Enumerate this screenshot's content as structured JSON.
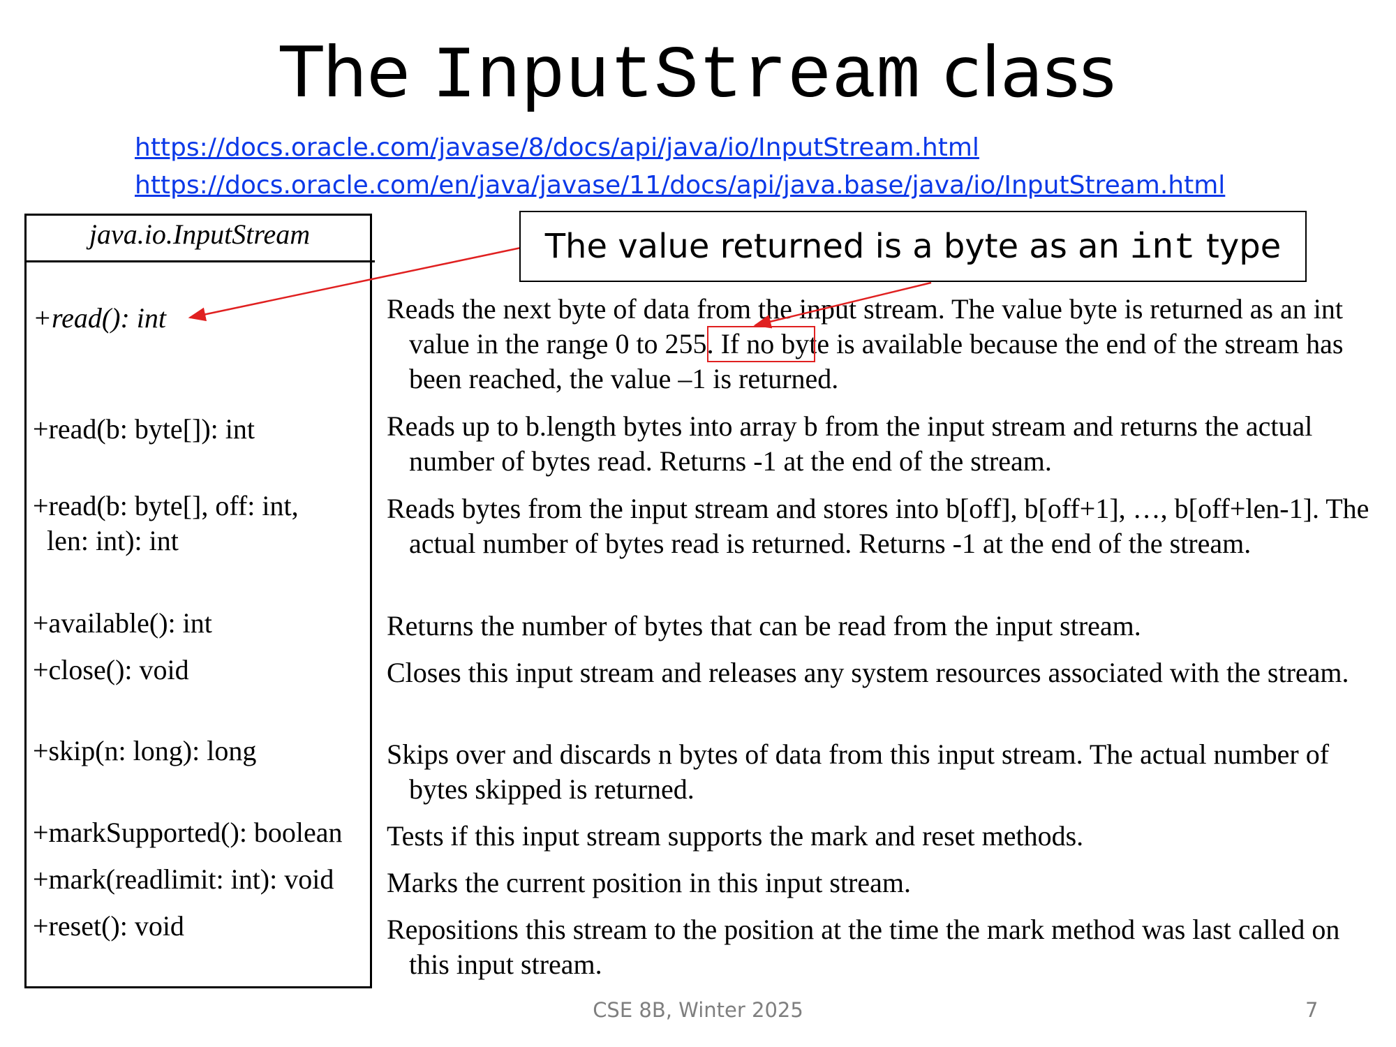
{
  "title": {
    "pre": "The ",
    "code": "InputStream",
    "post": " class"
  },
  "links": [
    "https://docs.oracle.com/javase/8/docs/api/java/io/InputStream.html",
    "https://docs.oracle.com/en/java/javase/11/docs/api/java.base/java/io/InputStream.html"
  ],
  "uml": {
    "class_name": "java.io.InputStream",
    "methods": [
      "+read(): int",
      "+read(b: byte[]): int",
      "+read(b: byte[], off: int,",
      "len: int): int",
      "+available(): int",
      "+close(): void",
      "+skip(n: long): long",
      "+markSupported(): boolean",
      "+mark(readlimit: int): void",
      "+reset(): void"
    ]
  },
  "descriptions": {
    "read": {
      "before": "Reads the next byte of data from the input stream. The value byte is returned as an int value in the range ",
      "highlight": "0 to 255",
      "after": ". If no byte is available because the end of the stream has been reached, the value –1 is returned."
    },
    "read_array": "Reads up to b.length bytes into array b from the input stream and returns the actual number of bytes read. Returns -1 at the end of the stream.",
    "read_offset": "Reads bytes from the input stream and stores into b[off], b[off+1], …, b[off+len-1]. The actual number of bytes read is returned. Returns -1 at the end of the stream.",
    "available": "Returns the number of bytes that can be read from the input stream.",
    "close": "Closes this input stream and releases any system resources associated with the stream.",
    "skip": "Skips over and discards n bytes of data from this input stream. The actual number of bytes skipped is returned.",
    "markSupported": "Tests if this input stream supports the mark and reset methods.",
    "mark": "Marks the current position in this input stream.",
    "reset": "Repositions this stream to the position at the time the mark method was last called on this input stream."
  },
  "callout": {
    "pre": "The value returned is a byte as an ",
    "code": "int",
    "post": " type"
  },
  "annotation_color": "#e02020",
  "link_color": "#0b38e8",
  "footer": {
    "course": "CSE 8B, Winter 2025",
    "page": "7"
  }
}
